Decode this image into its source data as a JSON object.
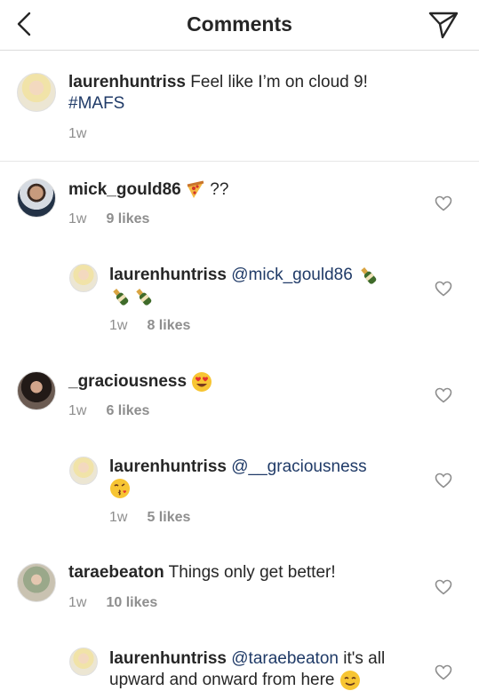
{
  "header": {
    "title": "Comments"
  },
  "caption": {
    "username": "laurenhuntriss",
    "text": "Feel like I’m on cloud 9!",
    "hashtag": "#MAFS",
    "time": "1w"
  },
  "comments": [
    {
      "username": "mick_gould86",
      "text": "??",
      "emoji": "pizza",
      "time": "1w",
      "likes": "9 likes"
    },
    {
      "username": "laurenhuntriss",
      "mention": "@mick_gould86",
      "emoji": "champagne",
      "time": "1w",
      "likes": "8 likes"
    },
    {
      "username": "_graciousness",
      "emoji": "heart-eyes",
      "time": "1w",
      "likes": "6 likes"
    },
    {
      "username": "laurenhuntriss",
      "mention": "@__graciousness",
      "emoji": "kissing-face",
      "time": "1w",
      "likes": "5 likes"
    },
    {
      "username": "taraebeaton",
      "text": "Things only get better!",
      "time": "1w",
      "likes": "10 likes"
    },
    {
      "username": "laurenhuntriss",
      "mention": "@taraebeaton",
      "text_line1": "it's all",
      "text_line2": "upward and onward from here",
      "emoji": "smiling-face"
    }
  ]
}
